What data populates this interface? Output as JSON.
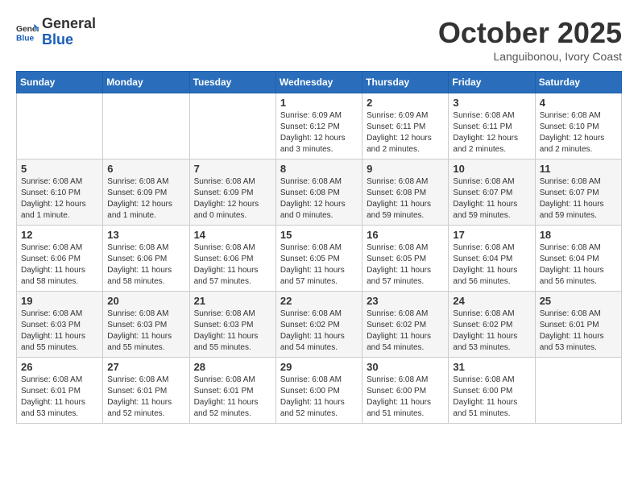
{
  "header": {
    "logo_line1": "General",
    "logo_line2": "Blue",
    "month_title": "October 2025",
    "subtitle": "Languibonou, Ivory Coast"
  },
  "days_of_week": [
    "Sunday",
    "Monday",
    "Tuesday",
    "Wednesday",
    "Thursday",
    "Friday",
    "Saturday"
  ],
  "weeks": [
    [
      {
        "day": "",
        "info": ""
      },
      {
        "day": "",
        "info": ""
      },
      {
        "day": "",
        "info": ""
      },
      {
        "day": "1",
        "info": "Sunrise: 6:09 AM\nSunset: 6:12 PM\nDaylight: 12 hours and 3 minutes."
      },
      {
        "day": "2",
        "info": "Sunrise: 6:09 AM\nSunset: 6:11 PM\nDaylight: 12 hours and 2 minutes."
      },
      {
        "day": "3",
        "info": "Sunrise: 6:08 AM\nSunset: 6:11 PM\nDaylight: 12 hours and 2 minutes."
      },
      {
        "day": "4",
        "info": "Sunrise: 6:08 AM\nSunset: 6:10 PM\nDaylight: 12 hours and 2 minutes."
      }
    ],
    [
      {
        "day": "5",
        "info": "Sunrise: 6:08 AM\nSunset: 6:10 PM\nDaylight: 12 hours and 1 minute."
      },
      {
        "day": "6",
        "info": "Sunrise: 6:08 AM\nSunset: 6:09 PM\nDaylight: 12 hours and 1 minute."
      },
      {
        "day": "7",
        "info": "Sunrise: 6:08 AM\nSunset: 6:09 PM\nDaylight: 12 hours and 0 minutes."
      },
      {
        "day": "8",
        "info": "Sunrise: 6:08 AM\nSunset: 6:08 PM\nDaylight: 12 hours and 0 minutes."
      },
      {
        "day": "9",
        "info": "Sunrise: 6:08 AM\nSunset: 6:08 PM\nDaylight: 11 hours and 59 minutes."
      },
      {
        "day": "10",
        "info": "Sunrise: 6:08 AM\nSunset: 6:07 PM\nDaylight: 11 hours and 59 minutes."
      },
      {
        "day": "11",
        "info": "Sunrise: 6:08 AM\nSunset: 6:07 PM\nDaylight: 11 hours and 59 minutes."
      }
    ],
    [
      {
        "day": "12",
        "info": "Sunrise: 6:08 AM\nSunset: 6:06 PM\nDaylight: 11 hours and 58 minutes."
      },
      {
        "day": "13",
        "info": "Sunrise: 6:08 AM\nSunset: 6:06 PM\nDaylight: 11 hours and 58 minutes."
      },
      {
        "day": "14",
        "info": "Sunrise: 6:08 AM\nSunset: 6:06 PM\nDaylight: 11 hours and 57 minutes."
      },
      {
        "day": "15",
        "info": "Sunrise: 6:08 AM\nSunset: 6:05 PM\nDaylight: 11 hours and 57 minutes."
      },
      {
        "day": "16",
        "info": "Sunrise: 6:08 AM\nSunset: 6:05 PM\nDaylight: 11 hours and 57 minutes."
      },
      {
        "day": "17",
        "info": "Sunrise: 6:08 AM\nSunset: 6:04 PM\nDaylight: 11 hours and 56 minutes."
      },
      {
        "day": "18",
        "info": "Sunrise: 6:08 AM\nSunset: 6:04 PM\nDaylight: 11 hours and 56 minutes."
      }
    ],
    [
      {
        "day": "19",
        "info": "Sunrise: 6:08 AM\nSunset: 6:03 PM\nDaylight: 11 hours and 55 minutes."
      },
      {
        "day": "20",
        "info": "Sunrise: 6:08 AM\nSunset: 6:03 PM\nDaylight: 11 hours and 55 minutes."
      },
      {
        "day": "21",
        "info": "Sunrise: 6:08 AM\nSunset: 6:03 PM\nDaylight: 11 hours and 55 minutes."
      },
      {
        "day": "22",
        "info": "Sunrise: 6:08 AM\nSunset: 6:02 PM\nDaylight: 11 hours and 54 minutes."
      },
      {
        "day": "23",
        "info": "Sunrise: 6:08 AM\nSunset: 6:02 PM\nDaylight: 11 hours and 54 minutes."
      },
      {
        "day": "24",
        "info": "Sunrise: 6:08 AM\nSunset: 6:02 PM\nDaylight: 11 hours and 53 minutes."
      },
      {
        "day": "25",
        "info": "Sunrise: 6:08 AM\nSunset: 6:01 PM\nDaylight: 11 hours and 53 minutes."
      }
    ],
    [
      {
        "day": "26",
        "info": "Sunrise: 6:08 AM\nSunset: 6:01 PM\nDaylight: 11 hours and 53 minutes."
      },
      {
        "day": "27",
        "info": "Sunrise: 6:08 AM\nSunset: 6:01 PM\nDaylight: 11 hours and 52 minutes."
      },
      {
        "day": "28",
        "info": "Sunrise: 6:08 AM\nSunset: 6:01 PM\nDaylight: 11 hours and 52 minutes."
      },
      {
        "day": "29",
        "info": "Sunrise: 6:08 AM\nSunset: 6:00 PM\nDaylight: 11 hours and 52 minutes."
      },
      {
        "day": "30",
        "info": "Sunrise: 6:08 AM\nSunset: 6:00 PM\nDaylight: 11 hours and 51 minutes."
      },
      {
        "day": "31",
        "info": "Sunrise: 6:08 AM\nSunset: 6:00 PM\nDaylight: 11 hours and 51 minutes."
      },
      {
        "day": "",
        "info": ""
      }
    ]
  ]
}
